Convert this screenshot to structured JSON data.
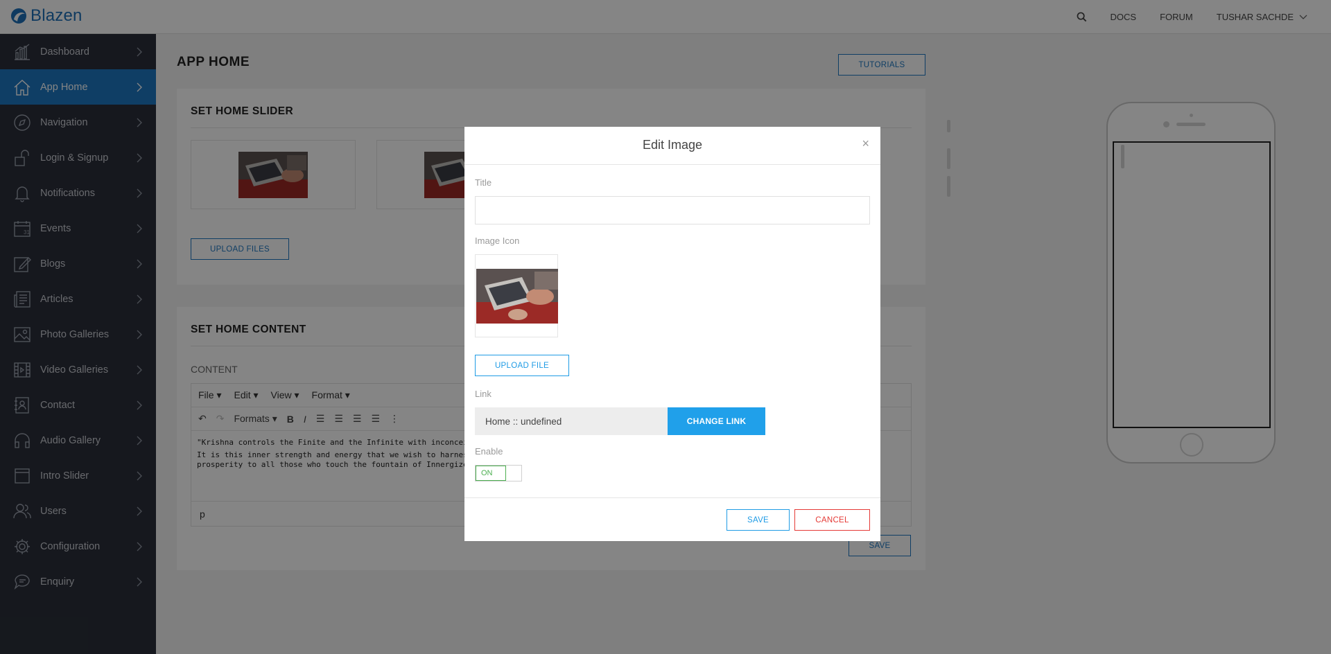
{
  "app": {
    "brand": "Blazen"
  },
  "topnav": {
    "docs": "DOCS",
    "forum": "FORUM",
    "user": "TUSHAR SACHDE"
  },
  "sidebar": {
    "items": [
      {
        "label": "Dashboard",
        "icon": "chart-icon"
      },
      {
        "label": "App Home",
        "icon": "home-icon",
        "active": true
      },
      {
        "label": "Navigation",
        "icon": "compass-icon"
      },
      {
        "label": "Login & Signup",
        "icon": "unlock-icon"
      },
      {
        "label": "Notifications",
        "icon": "bell-icon"
      },
      {
        "label": "Events",
        "icon": "calendar-icon"
      },
      {
        "label": "Blogs",
        "icon": "edit-icon"
      },
      {
        "label": "Articles",
        "icon": "newspaper-icon"
      },
      {
        "label": "Photo Galleries",
        "icon": "image-icon"
      },
      {
        "label": "Video Galleries",
        "icon": "film-icon"
      },
      {
        "label": "Contact",
        "icon": "contact-icon"
      },
      {
        "label": "Audio Gallery",
        "icon": "headphones-icon"
      },
      {
        "label": "Intro Slider",
        "icon": "slider-icon"
      },
      {
        "label": "Users",
        "icon": "users-icon"
      },
      {
        "label": "Configuration",
        "icon": "gear-icon"
      },
      {
        "label": "Enquiry",
        "icon": "chat-icon"
      }
    ]
  },
  "main": {
    "page_title": "APP HOME",
    "tutorials_label": "TUTORIALS",
    "slider_panel": {
      "title": "SET HOME SLIDER",
      "upload_label": "UPLOAD FILES"
    },
    "content_panel": {
      "title": "SET HOME CONTENT",
      "content_label": "CONTENT",
      "menu": [
        "File",
        "Edit",
        "View",
        "Format"
      ],
      "formats_label": "Formats",
      "body_line1": "\"Krishna controls the Finite and the Infinite with inconceivable supe",
      "body_line2": "It is this inner strength and energy that we wish to harness and deli",
      "body_line3": "prosperity to all those who touch the fountain of Innergize.",
      "status_path": "p",
      "save_label": "SAVE"
    }
  },
  "modal": {
    "title": "Edit Image",
    "close": "×",
    "title_label": "Title",
    "title_value": "",
    "image_icon_label": "Image Icon",
    "upload_label": "UPLOAD FILE",
    "link_label": "Link",
    "link_value": "Home :: undefined",
    "change_link_label": "CHANGE LINK",
    "enable_label": "Enable",
    "enable_state": "ON",
    "save_label": "SAVE",
    "cancel_label": "CANCEL"
  },
  "colors": {
    "sidebar_bg": "#2b2f3a",
    "active": "#1e78c2",
    "accent": "#20a0ea",
    "cancel": "#e53935",
    "toggle_on": "#4caf50"
  }
}
